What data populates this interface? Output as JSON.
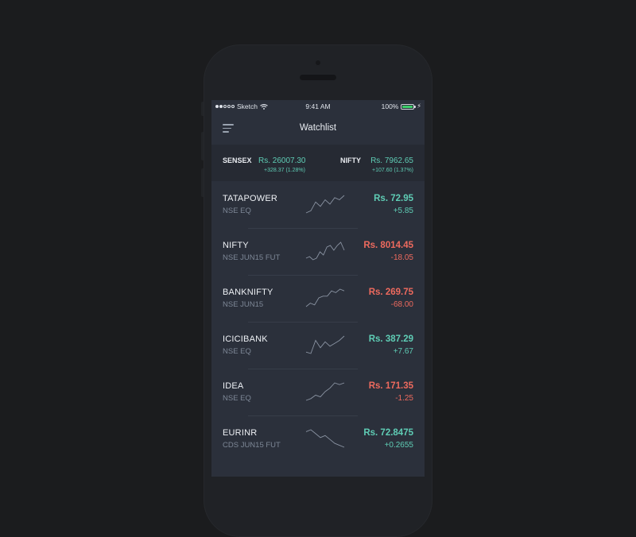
{
  "status_bar": {
    "carrier": "Sketch",
    "time": "9:41 AM",
    "battery": "100%",
    "signal_bars_filled": 2,
    "signal_bars_total": 5,
    "battery_level": 1.0
  },
  "nav": {
    "title": "Watchlist",
    "menu_icon": "hamburger-menu-icon"
  },
  "indices": [
    {
      "name": "SENSEX",
      "value": "Rs. 26007.30",
      "change": "+328.37 (1.28%)"
    },
    {
      "name": "NIFTY",
      "value": "Rs. 7962.65",
      "change": "+107.60 (1.37%)"
    }
  ],
  "watchlist": [
    {
      "symbol": "TATAPOWER",
      "exchange": "NSE EQ",
      "price": "Rs. 72.95",
      "change": "+5.85",
      "trend": "up",
      "sparkline": [
        6,
        7,
        11,
        9,
        12,
        10,
        13,
        12,
        14
      ]
    },
    {
      "symbol": "NIFTY",
      "exchange": "NSE JUN15 FUT",
      "price": "Rs. 8014.45",
      "change": "-18.05",
      "trend": "down",
      "sparkline": [
        4,
        5,
        3,
        4,
        8,
        6,
        11,
        12,
        9,
        12,
        14,
        9
      ]
    },
    {
      "symbol": "BANKNIFTY",
      "exchange": "NSE JUN15",
      "price": "Rs. 269.75",
      "change": "-68.00",
      "trend": "down",
      "sparkline": [
        3,
        5,
        4,
        8,
        9,
        9,
        12,
        11,
        13,
        12
      ]
    },
    {
      "symbol": "ICICIBANK",
      "exchange": "NSE EQ",
      "price": "Rs. 387.29",
      "change": "+7.67",
      "trend": "up",
      "sparkline": [
        6,
        5,
        14,
        9,
        13,
        10,
        12,
        14,
        17
      ]
    },
    {
      "symbol": "IDEA",
      "exchange": "NSE EQ",
      "price": "Rs. 171.35",
      "change": "-1.25",
      "trend": "down",
      "sparkline": [
        2,
        3,
        5,
        4,
        7,
        9,
        12,
        11,
        12
      ]
    },
    {
      "symbol": "EURINR",
      "exchange": "CDS JUN15 FUT",
      "price": "Rs. 72.8475",
      "change": "+0.2655",
      "trend": "up",
      "sparkline": [
        10,
        11,
        9,
        7,
        8,
        6,
        4,
        3,
        2
      ]
    }
  ],
  "colors": {
    "up": "#5fcdb5",
    "down": "#ee6a5e",
    "sparkline": "#8a93a2",
    "screen_bg": "#2b303b"
  }
}
